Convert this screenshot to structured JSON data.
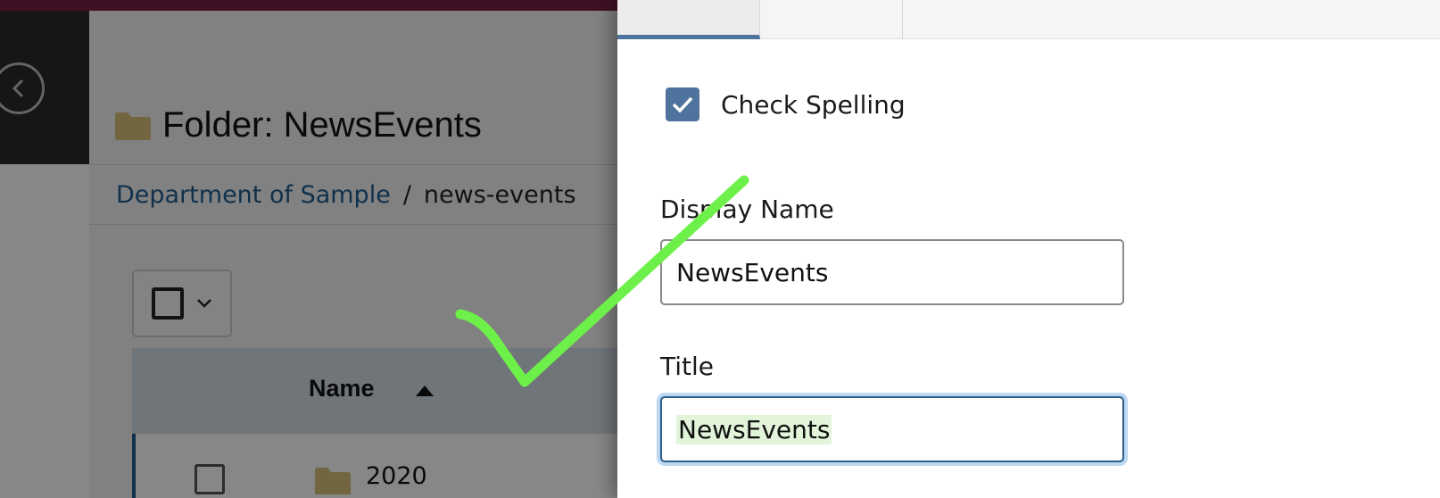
{
  "folder_page": {
    "title": "Folder: NewsEvents",
    "breadcrumb": {
      "link": "Department of Sample",
      "separator": "/",
      "current": "news-events"
    },
    "table": {
      "header_name": "Name",
      "rows": [
        {
          "name": "2020"
        }
      ]
    }
  },
  "edit_panel": {
    "check_spelling_label": "Check Spelling",
    "check_spelling_checked": true,
    "display_name_label": "Display Name",
    "display_name_value": "NewsEvents",
    "title_label": "Title",
    "title_value": "NewsEvents"
  },
  "colors": {
    "topbar": "#7a1f45",
    "accent_blue": "#4e739c",
    "annotation_green": "#6ef04a",
    "folder_icon": "#d8c07a"
  },
  "icons": [
    "chevron-left-icon",
    "folder-icon",
    "chevron-down-icon",
    "sort-ascending-icon",
    "checkmark-icon"
  ]
}
